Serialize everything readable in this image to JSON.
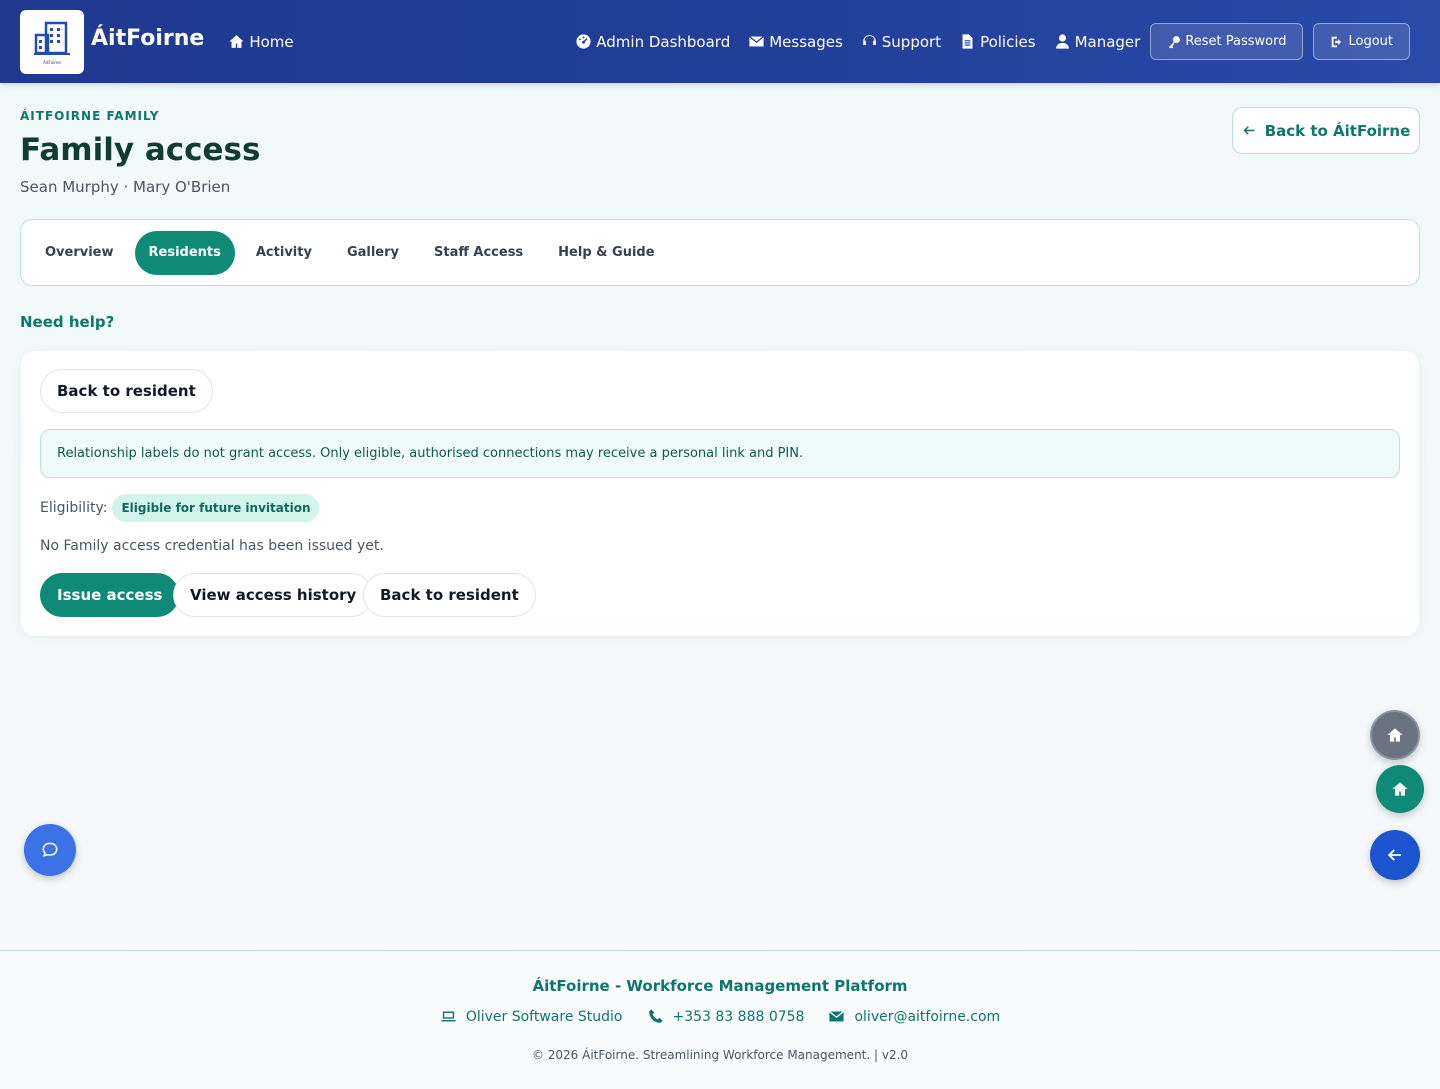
{
  "nav": {
    "brand": "ÁitFoirne",
    "logo_caption": "ÁitFoirne",
    "home": "Home",
    "links": [
      "Admin Dashboard",
      "Messages",
      "Support",
      "Policies",
      "Manager"
    ],
    "reset_password": "Reset Password",
    "logout": "Logout",
    "colors": {
      "bar": "#213e98"
    }
  },
  "header": {
    "eyebrow": "ÁITFOIRNE FAMILY",
    "title": "Family access",
    "subtitle": "Sean Murphy · Mary O'Brien",
    "back_link": "Back to ÁitFoirne"
  },
  "tabs": [
    {
      "label": "Overview",
      "active": false
    },
    {
      "label": "Residents",
      "active": true
    },
    {
      "label": "Activity",
      "active": false
    },
    {
      "label": "Gallery",
      "active": false
    },
    {
      "label": "Staff Access",
      "active": false
    },
    {
      "label": "Help & Guide",
      "active": false
    }
  ],
  "need_help": "Need help?",
  "card": {
    "back_to_resident": "Back to resident",
    "notice": "Relationship labels do not grant access. Only eligible, authorised connections may receive a personal link and PIN.",
    "eligibility_label": "Eligibility:",
    "eligibility_badge": "Eligible for future invitation",
    "no_credential": "No Family access credential has been issued yet.",
    "actions": {
      "issue": "Issue access",
      "history": "View access history",
      "back": "Back to resident"
    },
    "accent_color": "#0f8a77"
  },
  "icons": {
    "chat": "chat-bubble-icon",
    "home_grey": "home-icon",
    "home_green": "home-icon",
    "back": "arrow-left-icon"
  },
  "footer": {
    "title": "ÁitFoirne - Workforce Management Platform",
    "studio": "Oliver Software Studio",
    "phone": "+353 83 888 0758",
    "email": "oliver@aitfoirne.com",
    "copyright": "© 2026 ÁitFoirne. Streamlining Workforce Management. | v2.0"
  }
}
